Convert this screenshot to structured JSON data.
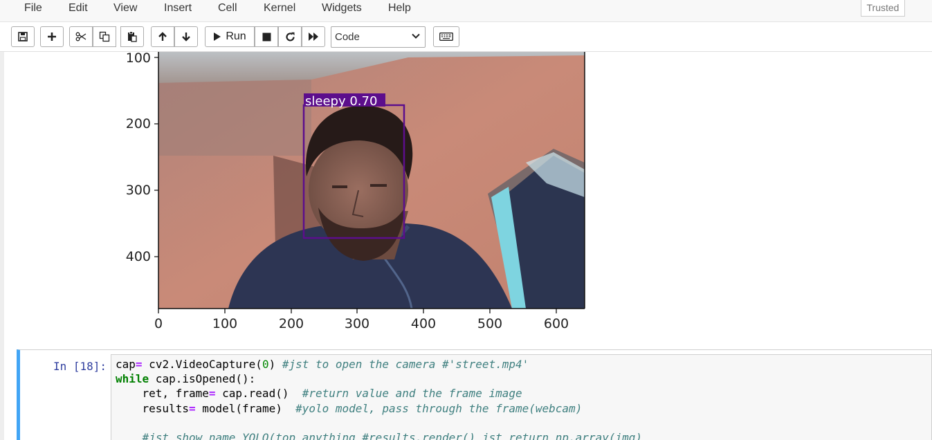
{
  "menubar": {
    "items": [
      "File",
      "Edit",
      "View",
      "Insert",
      "Cell",
      "Kernel",
      "Widgets",
      "Help"
    ],
    "trusted": "Trusted"
  },
  "toolbar": {
    "run_label": "Run",
    "cell_type": "Code",
    "icons": [
      "save-icon",
      "plus-icon",
      "scissors-icon",
      "copy-icon",
      "paste-icon",
      "arrow-up-icon",
      "arrow-down-icon",
      "play-icon",
      "stop-icon",
      "restart-icon",
      "fast-forward-icon",
      "keyboard-icon"
    ]
  },
  "output": {
    "detection_label": "sleepy 0.70",
    "box_color": "#5c0e8c",
    "y_ticks": [
      "100",
      "200",
      "300",
      "400"
    ],
    "x_ticks": [
      "0",
      "100",
      "200",
      "300",
      "400",
      "500",
      "600"
    ]
  },
  "cell": {
    "prompt": "In [18]:",
    "lines": [
      {
        "a": "cap",
        "b": "=",
        "c": " cv2.VideoCapture(",
        "d": "0",
        "e": ") ",
        "f": "#jst to open the camera #'street.mp4'"
      },
      {
        "kw": "while",
        "rest": " cap.isOpened():"
      },
      {
        "a": "    ret, frame",
        "b": "=",
        "c": " cap.read()  ",
        "f": "#return value and the frame image"
      },
      {
        "a": "    results",
        "b": "=",
        "c": " model(frame)  ",
        "f": "#yolo model, pass through the frame(webcam)"
      },
      {
        "f": "    #jst show name YOLO(top anything #results.render() jst return np.array(img)"
      }
    ]
  },
  "colors": {
    "accent": "#42a5f5",
    "prompt": "#303f9f"
  }
}
